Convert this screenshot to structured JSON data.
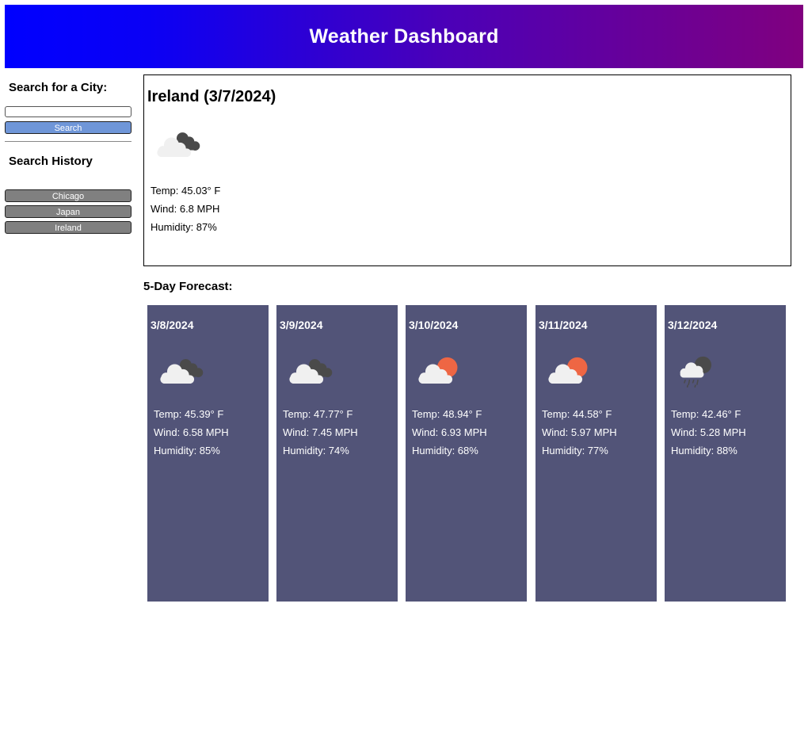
{
  "header": {
    "title": "Weather Dashboard"
  },
  "sidebar": {
    "search_title": "Search for a City:",
    "search_placeholder": "",
    "search_value": "",
    "search_button": "Search",
    "history_title": "Search History",
    "history": [
      "Chicago",
      "Japan",
      "Ireland"
    ]
  },
  "current": {
    "title": "Ireland (3/7/2024)",
    "icon": "cloud-icon",
    "temp": "Temp: 45.03° F",
    "wind": "Wind: 6.8 MPH",
    "humidity": "Humidity: 87%"
  },
  "forecast": {
    "title": "5-Day Forecast:",
    "days": [
      {
        "date": "3/8/2024",
        "icon": "cloud-icon",
        "temp": "Temp: 45.39° F",
        "wind": "Wind: 6.58 MPH",
        "humidity": "Humidity: 85%"
      },
      {
        "date": "3/9/2024",
        "icon": "cloud-icon",
        "temp": "Temp: 47.77° F",
        "wind": "Wind: 7.45 MPH",
        "humidity": "Humidity: 74%"
      },
      {
        "date": "3/10/2024",
        "icon": "partly-cloudy-icon",
        "temp": "Temp: 48.94° F",
        "wind": "Wind: 6.93 MPH",
        "humidity": "Humidity: 68%"
      },
      {
        "date": "3/11/2024",
        "icon": "partly-cloudy-icon",
        "temp": "Temp: 44.58° F",
        "wind": "Wind: 5.97 MPH",
        "humidity": "Humidity: 77%"
      },
      {
        "date": "3/12/2024",
        "icon": "rain-icon",
        "temp": "Temp: 42.46° F",
        "wind": "Wind: 5.28 MPH",
        "humidity": "Humidity: 88%"
      }
    ]
  },
  "colors": {
    "header_gradient_start": "#0000ff",
    "header_gradient_end": "#80007f",
    "search_button": "#6f96d8",
    "history_button": "#808080",
    "forecast_card": "#525478",
    "sun": "#ee6644",
    "dark_cloud": "#4a4a4a",
    "light_cloud": "#f0f0f0"
  }
}
